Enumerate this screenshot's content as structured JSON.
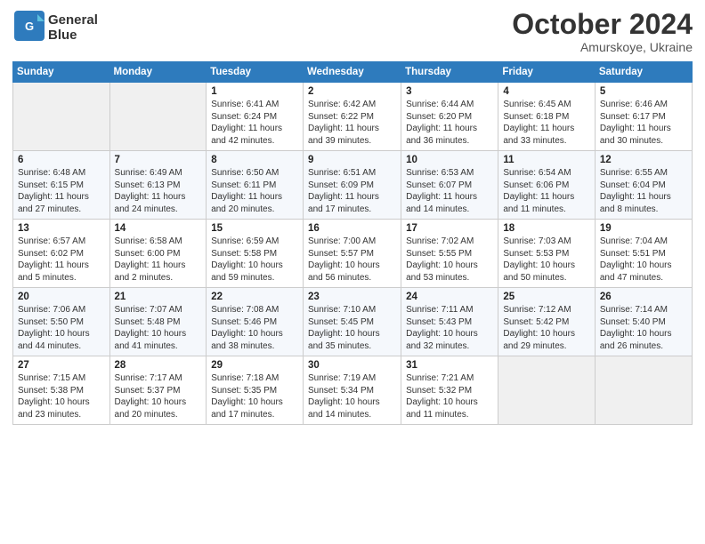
{
  "header": {
    "logo_line1": "General",
    "logo_line2": "Blue",
    "month": "October 2024",
    "location": "Amurskoye, Ukraine"
  },
  "weekdays": [
    "Sunday",
    "Monday",
    "Tuesday",
    "Wednesday",
    "Thursday",
    "Friday",
    "Saturday"
  ],
  "weeks": [
    [
      {
        "day": "",
        "info": ""
      },
      {
        "day": "",
        "info": ""
      },
      {
        "day": "1",
        "info": "Sunrise: 6:41 AM\nSunset: 6:24 PM\nDaylight: 11 hours and 42 minutes."
      },
      {
        "day": "2",
        "info": "Sunrise: 6:42 AM\nSunset: 6:22 PM\nDaylight: 11 hours and 39 minutes."
      },
      {
        "day": "3",
        "info": "Sunrise: 6:44 AM\nSunset: 6:20 PM\nDaylight: 11 hours and 36 minutes."
      },
      {
        "day": "4",
        "info": "Sunrise: 6:45 AM\nSunset: 6:18 PM\nDaylight: 11 hours and 33 minutes."
      },
      {
        "day": "5",
        "info": "Sunrise: 6:46 AM\nSunset: 6:17 PM\nDaylight: 11 hours and 30 minutes."
      }
    ],
    [
      {
        "day": "6",
        "info": "Sunrise: 6:48 AM\nSunset: 6:15 PM\nDaylight: 11 hours and 27 minutes."
      },
      {
        "day": "7",
        "info": "Sunrise: 6:49 AM\nSunset: 6:13 PM\nDaylight: 11 hours and 24 minutes."
      },
      {
        "day": "8",
        "info": "Sunrise: 6:50 AM\nSunset: 6:11 PM\nDaylight: 11 hours and 20 minutes."
      },
      {
        "day": "9",
        "info": "Sunrise: 6:51 AM\nSunset: 6:09 PM\nDaylight: 11 hours and 17 minutes."
      },
      {
        "day": "10",
        "info": "Sunrise: 6:53 AM\nSunset: 6:07 PM\nDaylight: 11 hours and 14 minutes."
      },
      {
        "day": "11",
        "info": "Sunrise: 6:54 AM\nSunset: 6:06 PM\nDaylight: 11 hours and 11 minutes."
      },
      {
        "day": "12",
        "info": "Sunrise: 6:55 AM\nSunset: 6:04 PM\nDaylight: 11 hours and 8 minutes."
      }
    ],
    [
      {
        "day": "13",
        "info": "Sunrise: 6:57 AM\nSunset: 6:02 PM\nDaylight: 11 hours and 5 minutes."
      },
      {
        "day": "14",
        "info": "Sunrise: 6:58 AM\nSunset: 6:00 PM\nDaylight: 11 hours and 2 minutes."
      },
      {
        "day": "15",
        "info": "Sunrise: 6:59 AM\nSunset: 5:58 PM\nDaylight: 10 hours and 59 minutes."
      },
      {
        "day": "16",
        "info": "Sunrise: 7:00 AM\nSunset: 5:57 PM\nDaylight: 10 hours and 56 minutes."
      },
      {
        "day": "17",
        "info": "Sunrise: 7:02 AM\nSunset: 5:55 PM\nDaylight: 10 hours and 53 minutes."
      },
      {
        "day": "18",
        "info": "Sunrise: 7:03 AM\nSunset: 5:53 PM\nDaylight: 10 hours and 50 minutes."
      },
      {
        "day": "19",
        "info": "Sunrise: 7:04 AM\nSunset: 5:51 PM\nDaylight: 10 hours and 47 minutes."
      }
    ],
    [
      {
        "day": "20",
        "info": "Sunrise: 7:06 AM\nSunset: 5:50 PM\nDaylight: 10 hours and 44 minutes."
      },
      {
        "day": "21",
        "info": "Sunrise: 7:07 AM\nSunset: 5:48 PM\nDaylight: 10 hours and 41 minutes."
      },
      {
        "day": "22",
        "info": "Sunrise: 7:08 AM\nSunset: 5:46 PM\nDaylight: 10 hours and 38 minutes."
      },
      {
        "day": "23",
        "info": "Sunrise: 7:10 AM\nSunset: 5:45 PM\nDaylight: 10 hours and 35 minutes."
      },
      {
        "day": "24",
        "info": "Sunrise: 7:11 AM\nSunset: 5:43 PM\nDaylight: 10 hours and 32 minutes."
      },
      {
        "day": "25",
        "info": "Sunrise: 7:12 AM\nSunset: 5:42 PM\nDaylight: 10 hours and 29 minutes."
      },
      {
        "day": "26",
        "info": "Sunrise: 7:14 AM\nSunset: 5:40 PM\nDaylight: 10 hours and 26 minutes."
      }
    ],
    [
      {
        "day": "27",
        "info": "Sunrise: 7:15 AM\nSunset: 5:38 PM\nDaylight: 10 hours and 23 minutes."
      },
      {
        "day": "28",
        "info": "Sunrise: 7:17 AM\nSunset: 5:37 PM\nDaylight: 10 hours and 20 minutes."
      },
      {
        "day": "29",
        "info": "Sunrise: 7:18 AM\nSunset: 5:35 PM\nDaylight: 10 hours and 17 minutes."
      },
      {
        "day": "30",
        "info": "Sunrise: 7:19 AM\nSunset: 5:34 PM\nDaylight: 10 hours and 14 minutes."
      },
      {
        "day": "31",
        "info": "Sunrise: 7:21 AM\nSunset: 5:32 PM\nDaylight: 10 hours and 11 minutes."
      },
      {
        "day": "",
        "info": ""
      },
      {
        "day": "",
        "info": ""
      }
    ]
  ]
}
